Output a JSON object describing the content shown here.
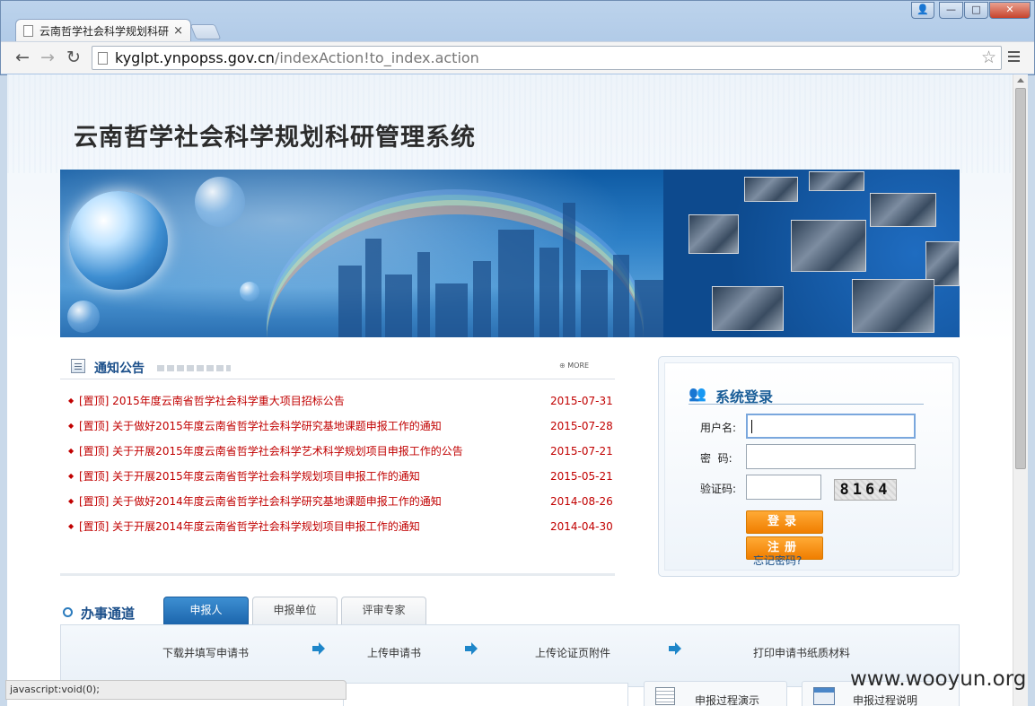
{
  "browser": {
    "tab_title": "云南哲学社会科学规划科研",
    "tab_close": "×",
    "url_host": "kyglpt.ynpopss.gov.cn",
    "url_path": "/indexAction!to_index.action",
    "back": "←",
    "forward": "→",
    "reload": "↻",
    "star": "☆",
    "window_buttons": {
      "user": "👤",
      "minimize": "—",
      "maximize": "□",
      "close": "✕"
    }
  },
  "site": {
    "title": "云南哲学社会科学规划科研管理系统"
  },
  "notice": {
    "heading": "通知公告",
    "more": "MORE",
    "items": [
      {
        "text": "[置顶] 2015年度云南省哲学社会科学重大项目招标公告",
        "date": "2015-07-31"
      },
      {
        "text": "[置顶] 关于做好2015年度云南省哲学社会科学研究基地课题申报工作的通知",
        "date": "2015-07-28"
      },
      {
        "text": "[置顶] 关于开展2015年度云南省哲学社会科学艺术科学规划项目申报工作的公告",
        "date": "2015-07-21"
      },
      {
        "text": "[置顶] 关于开展2015年度云南省哲学社会科学规划项目申报工作的通知",
        "date": "2015-05-21"
      },
      {
        "text": "[置顶] 关于做好2014年度云南省哲学社会科学研究基地课题申报工作的通知",
        "date": "2014-08-26"
      },
      {
        "text": "[置顶] 关于开展2014年度云南省哲学社会科学规划项目申报工作的通知",
        "date": "2014-04-30"
      }
    ]
  },
  "login": {
    "heading": "系统登录",
    "username_label": "用户名:",
    "password_label": "密  码:",
    "captcha_label": "验证码:",
    "captcha_value": "8164",
    "username_value": "",
    "password_value": "",
    "captcha_input_value": "",
    "login_button": "登录",
    "register_button": "注册",
    "forgot_link": "忘记密码?"
  },
  "service": {
    "heading": "办事通道",
    "tabs": [
      "申报人",
      "申报单位",
      "评审专家"
    ],
    "active_tab": 0,
    "steps": [
      "下载并填写申请书",
      "上传申请书",
      "上传论证页附件",
      "打印申请书纸质材料"
    ],
    "cards": [
      "申报过程演示",
      "申报过程说明"
    ]
  },
  "status_bar": "javascript:void(0);",
  "watermark": "www.wooyun.org",
  "colors": {
    "notice_text": "#c10000",
    "heading_blue": "#1b4f8a",
    "login_button": "#f08a00",
    "active_tab": "#2a7bc2"
  }
}
